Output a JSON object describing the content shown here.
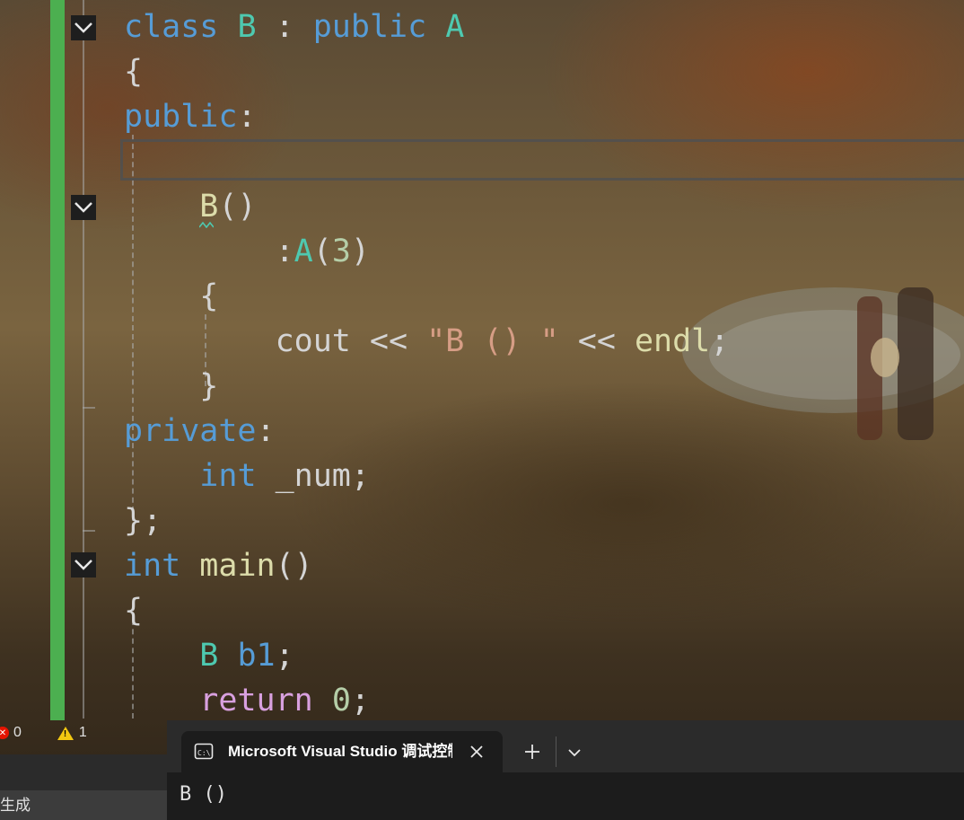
{
  "editor": {
    "lines": [
      [
        {
          "t": "class",
          "c": "kw"
        },
        {
          "t": " "
        },
        {
          "t": "B",
          "c": "ty"
        },
        {
          "t": " : "
        },
        {
          "t": "public",
          "c": "kw"
        },
        {
          "t": " "
        },
        {
          "t": "A",
          "c": "ty"
        }
      ],
      [
        {
          "t": "{"
        }
      ],
      [
        {
          "t": "public",
          "c": "kw"
        },
        {
          "t": ":"
        }
      ],
      [
        {
          "t": ""
        }
      ],
      [
        {
          "t": "    "
        },
        {
          "t": "B",
          "c": "fn"
        },
        {
          "t": "()"
        }
      ],
      [
        {
          "t": "        :"
        },
        {
          "t": "A",
          "c": "ty"
        },
        {
          "t": "("
        },
        {
          "t": "3",
          "c": "num"
        },
        {
          "t": ")"
        }
      ],
      [
        {
          "t": "    {"
        }
      ],
      [
        {
          "t": "        cout << "
        },
        {
          "t": "\"B () \"",
          "c": "str"
        },
        {
          "t": " << "
        },
        {
          "t": "endl",
          "c": "fn"
        },
        {
          "t": ";"
        }
      ],
      [
        {
          "t": "    }"
        }
      ],
      [
        {
          "t": "private",
          "c": "kw"
        },
        {
          "t": ":"
        }
      ],
      [
        {
          "t": "    "
        },
        {
          "t": "int",
          "c": "kw"
        },
        {
          "t": " _num;"
        }
      ],
      [
        {
          "t": "};"
        }
      ],
      [
        {
          "t": "int",
          "c": "kw"
        },
        {
          "t": " "
        },
        {
          "t": "main",
          "c": "fn"
        },
        {
          "t": "()"
        }
      ],
      [
        {
          "t": "{"
        }
      ],
      [
        {
          "t": "    "
        },
        {
          "t": "B",
          "c": "ty"
        },
        {
          "t": " "
        },
        {
          "t": "b1",
          "c": "kw"
        },
        {
          "t": ";"
        }
      ],
      [
        {
          "t": "    "
        },
        {
          "t": "return",
          "c": "ctl"
        },
        {
          "t": " "
        },
        {
          "t": "0",
          "c": "num"
        },
        {
          "t": ";"
        }
      ]
    ]
  },
  "status": {
    "errors": "0",
    "warnings": "1",
    "build_label": "生成"
  },
  "terminal": {
    "tab_title": "Microsoft Visual Studio 调试控制台",
    "output": "B ()"
  },
  "colors": {
    "keyword": "#569cd6",
    "type": "#4ec9b0",
    "function": "#dcdcaa",
    "string": "#d69d85",
    "number": "#b5cea8",
    "control": "#d8a0df",
    "gutter_modified": "#4caf50"
  },
  "icons": {
    "fold": "chevron-down-icon",
    "error": "error-icon",
    "warning": "warning-icon",
    "terminal": "terminal-icon",
    "close": "close-icon",
    "new_tab": "plus-icon",
    "dropdown": "chevron-down-icon"
  }
}
